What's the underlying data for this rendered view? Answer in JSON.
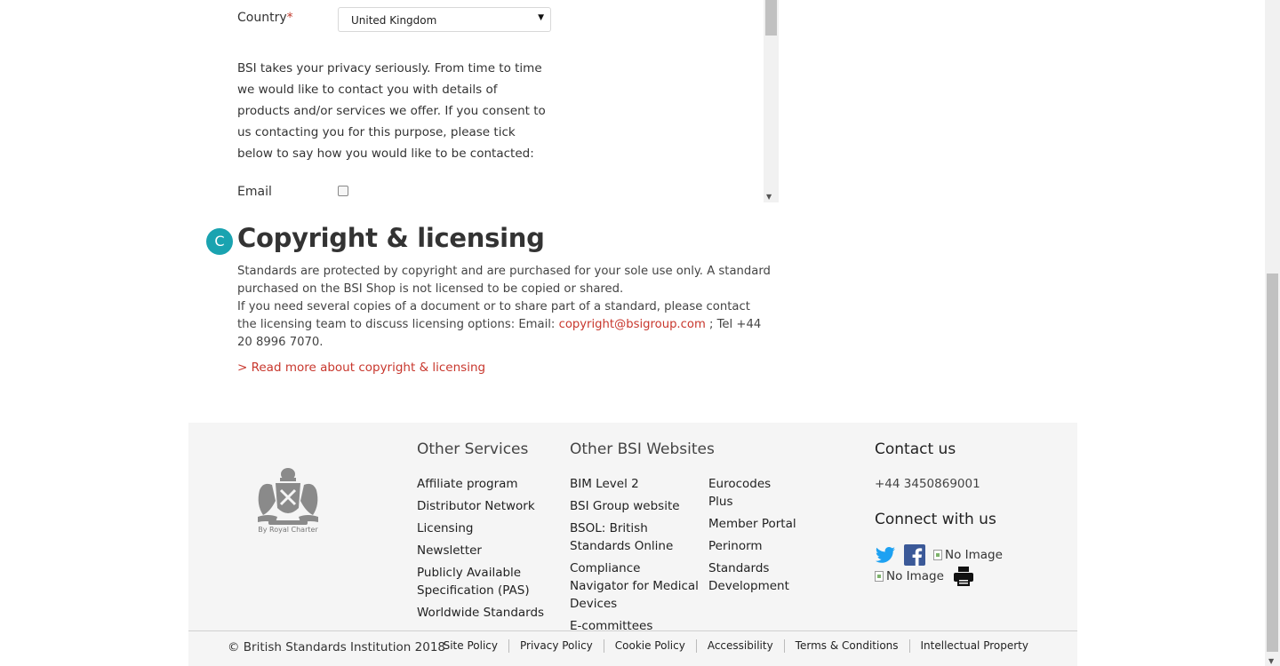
{
  "form": {
    "country_label": "Country",
    "required_mark": "*",
    "country_value": "United Kingdom",
    "privacy_text": "BSI takes your privacy seriously. From time to time we would like to contact you with details of products and/or services we offer. If you consent to us contacting you for this purpose, please tick below to say how you would like to be contacted:",
    "email_label": "Email",
    "email_checked": false
  },
  "section": {
    "badge": "C",
    "title": "Copyright & licensing",
    "para1": "Standards are protected by copyright and are purchased for your sole use only. A standard purchased on the BSI Shop is not licensed to be copied or shared.",
    "para2_start": "If you need several copies of a document or to share part of a standard, please contact the licensing team to discuss licensing options: Email: ",
    "email_link": "copyright@bsigroup.com",
    "para2_end": " ; Tel +44 20 8996 7070.",
    "read_more": "> Read more about copyright & licensing"
  },
  "footer": {
    "crest_caption": "By Royal Charter",
    "other_services": {
      "heading": "Other Services",
      "items": [
        "Affiliate program",
        "Distributor Network",
        "Licensing",
        "Newsletter",
        "Publicly Available Specification (PAS)",
        "Worldwide Standards"
      ]
    },
    "other_websites": {
      "heading": "Other BSI Websites",
      "col1": [
        "BIM Level 2",
        "BSI Group website",
        "BSOL: British Standards Online",
        "Compliance Navigator for Medical Devices",
        "E-committees"
      ],
      "col2": [
        "Eurocodes Plus",
        "Member Portal",
        "Perinorm",
        "Standards Development"
      ]
    },
    "contact": {
      "heading": "Contact us",
      "phone": "+44 3450869001",
      "connect_heading": "Connect with us",
      "no_image_1": "No Image",
      "no_image_2": "No Image"
    },
    "colors": {
      "twitter": "#1da1f2",
      "facebook": "#3b5998",
      "accent_red": "#c8372d",
      "badge_teal": "#1aa3b0"
    },
    "copyright": "© British Standards Institution 2018",
    "policy_links": [
      "Site Policy",
      "Privacy Policy",
      "Cookie Policy",
      "Accessibility",
      "Terms & Conditions",
      "Intellectual Property"
    ]
  }
}
